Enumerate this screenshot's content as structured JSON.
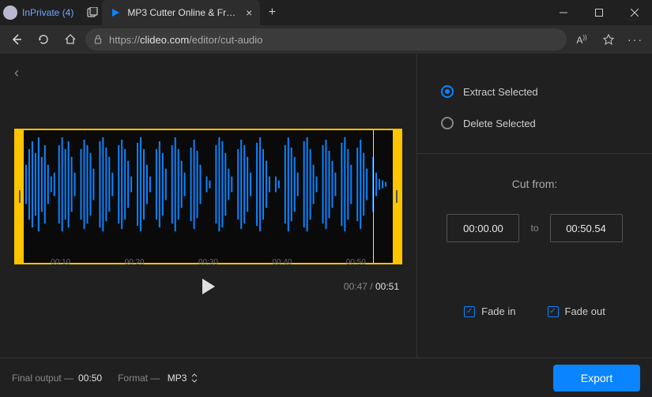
{
  "browser": {
    "inprivate_label": "InPrivate (4)",
    "tab_title": "MP3 Cutter Online & Free — Cut",
    "url_prefix": "https://",
    "url_domain": "clideo.com",
    "url_path": "/editor/cut-audio"
  },
  "waveform": {
    "ticks": [
      "00:10",
      "00:20",
      "00:30",
      "00:40",
      "00:50"
    ],
    "current_time": "00:47",
    "total_time": "00:51"
  },
  "options": {
    "extract_label": "Extract Selected",
    "delete_label": "Delete Selected"
  },
  "cut": {
    "heading": "Cut from:",
    "start": "00:00.00",
    "to": "to",
    "end": "00:50.54"
  },
  "fade": {
    "in_label": "Fade in",
    "out_label": "Fade out"
  },
  "footer": {
    "final_output_label": "Final output —",
    "final_output_value": "00:50",
    "format_label": "Format —",
    "format_value": "MP3",
    "export_label": "Export"
  }
}
